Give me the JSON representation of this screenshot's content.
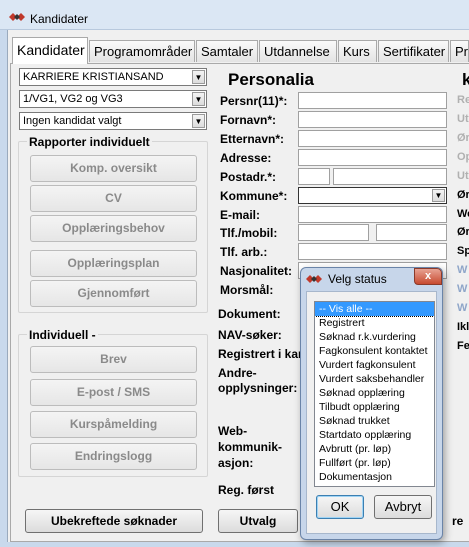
{
  "window": {
    "title": "Kandidater"
  },
  "tabs": [
    "Kandidater",
    "Programområder",
    "Samtaler",
    "Utdannelse",
    "Kurs",
    "Sertifikater",
    "Pr"
  ],
  "filters": {
    "region": "KARRIERE KRISTIANSAND",
    "level": "1/VG1, VG2 og VG3",
    "candidate": "Ingen kandidat valgt"
  },
  "reports_individual": {
    "title": "Rapporter individuelt",
    "buttons": [
      "Komp. oversikt",
      "CV",
      "Opplæringsbehov",
      "Opplæringsplan",
      "Gjennomført"
    ]
  },
  "individual": {
    "title": "Individuell -",
    "buttons": [
      "Brev",
      "E-post / SMS",
      "Kurspåmelding",
      "Endringslogg"
    ]
  },
  "personalia": {
    "title": "Personalia",
    "fields": {
      "persnr": "Persnr(11)*:",
      "fornavn": "Fornavn*:",
      "etternavn": "Etternavn*:",
      "adresse": "Adresse:",
      "postadr": "Postadr.*:",
      "kommune": "Kommune*:",
      "email": "E-mail:",
      "tlf_mobil": "Tlf./mobil:",
      "tlf_arb": "Tlf. arb.:",
      "nasjonalitet": "Nasjonalitet:",
      "morsmal": "Morsmål:",
      "dokument": "Dokument:",
      "nav_soker": "NAV-søker:",
      "registrert": "Registrert i kar",
      "andre_line1": "Andre-",
      "andre_line2": "opplysninger:",
      "web_line1": "Web-",
      "web_line2": "kommunik-",
      "web_line3": "asjon:",
      "reg_forst": "Reg. først"
    }
  },
  "right_column_partial": {
    "k": "k",
    "rows": [
      "Re",
      "Ut",
      "Ør",
      "Op",
      "Ut",
      "Ør",
      "We",
      "Ør",
      "Sp",
      "W",
      "W",
      "W",
      "Ikl",
      "Fe"
    ]
  },
  "bottom": {
    "confirm_button": "Ubekreftede søknader",
    "select_button": "Utvalg",
    "partial_right": "re"
  },
  "status_dialog": {
    "title": "Velg status",
    "close_label": "x",
    "selected": "-- Vis alle --",
    "options": [
      "-- Vis alle --",
      "Registrert",
      "Søknad r.k.vurdering",
      "Fagkonsulent kontaktet",
      "Vurdert fagkonsulent",
      "Vurdert saksbehandler",
      "Søknad opplæring",
      "Tilbudt opplæring",
      "Søknad trukket",
      "Startdato opplæring",
      "Avbrutt (pr. løp)",
      "Fullført (pr. løp)",
      "Dokumentasjon"
    ],
    "ok": "OK",
    "cancel": "Avbryt"
  },
  "colors": {
    "accent_red": "#c0392b",
    "selection": "#3399ff",
    "title_bar": "#dbe7f4"
  }
}
